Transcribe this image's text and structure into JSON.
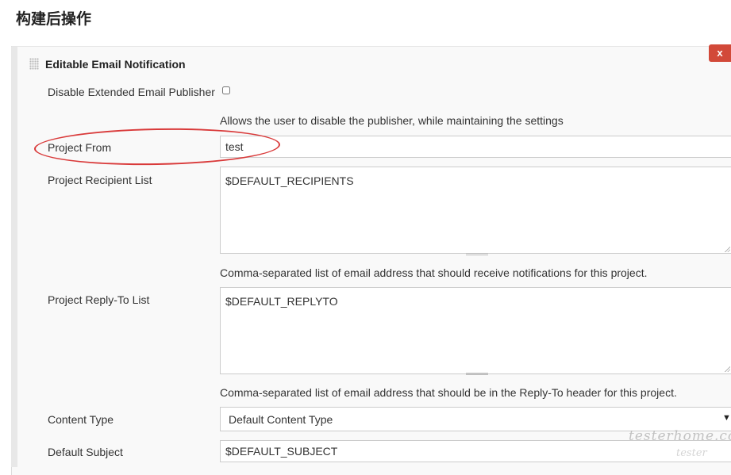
{
  "section": {
    "title": "构建后操作"
  },
  "panel": {
    "heading": "Editable Email Notification",
    "delete_label": "x"
  },
  "form": {
    "disable_publisher": {
      "label": "Disable Extended Email Publisher",
      "checked": false,
      "help": "Allows the user to disable the publisher, while maintaining the settings"
    },
    "project_from": {
      "label": "Project From",
      "value": "test"
    },
    "recipient_list": {
      "label": "Project Recipient List",
      "value": "$DEFAULT_RECIPIENTS",
      "help": "Comma-separated list of email address that should receive notifications for this project."
    },
    "reply_to_list": {
      "label": "Project Reply-To List",
      "value": "$DEFAULT_REPLYTO",
      "help": "Comma-separated list of email address that should be in the Reply-To header for this project."
    },
    "content_type": {
      "label": "Content Type",
      "selected": "Default Content Type",
      "arrow_icon": "dropdown-arrow-icon"
    },
    "default_subject": {
      "label": "Default Subject",
      "value": "$DEFAULT_SUBJECT"
    }
  },
  "annotation": {
    "color": "#d93a3a"
  },
  "watermark": {
    "text": "testerhome.com",
    "text2": "tester"
  },
  "colors": {
    "delete_button": "#d24939",
    "panel_bg": "#f9f9f9"
  }
}
